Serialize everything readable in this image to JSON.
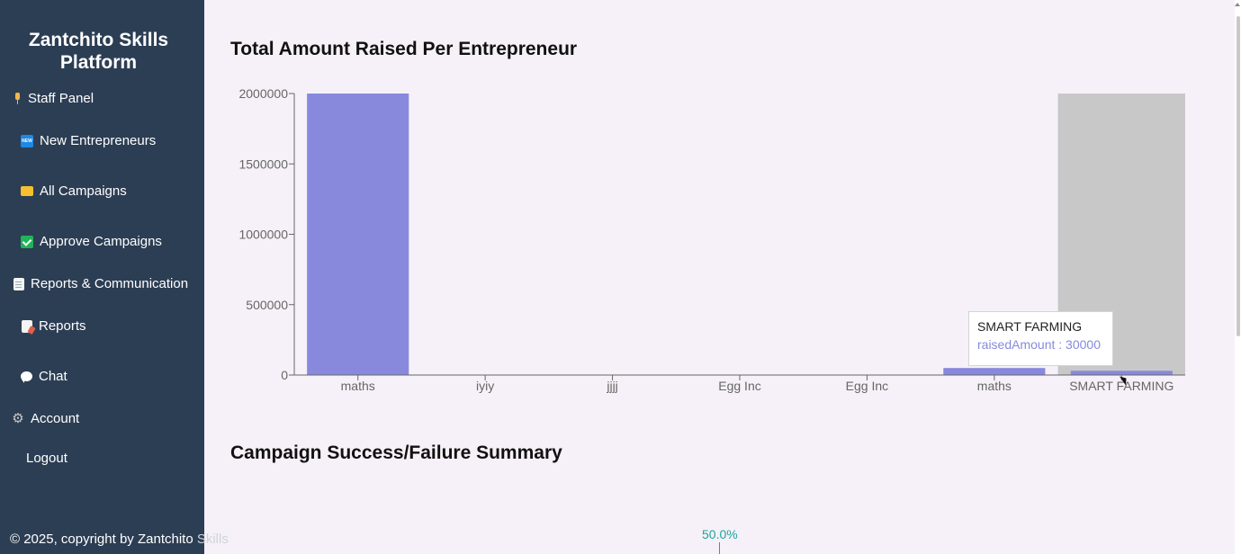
{
  "sidebar": {
    "brand": "Zantchito Skills Platform",
    "items": [
      {
        "label": "Staff Panel",
        "icon": "pushpin-icon"
      },
      {
        "label": "New Entrepreneurs",
        "icon": "new-badge-icon"
      },
      {
        "label": "All Campaigns",
        "icon": "folder-icon"
      },
      {
        "label": "Approve Campaigns",
        "icon": "checkmark-icon"
      },
      {
        "label": "Reports & Communication",
        "icon": "document-icon"
      },
      {
        "label": "Reports",
        "icon": "memo-icon"
      },
      {
        "label": "Chat",
        "icon": "speech-bubble-icon"
      },
      {
        "label": "Account",
        "icon": "gear-icon"
      },
      {
        "label": "Logout",
        "icon": ""
      }
    ]
  },
  "footer": {
    "text_main": "© 2025, copyright by Zantchito ",
    "text_faded": "Skills"
  },
  "main": {
    "chart_title": "Total Amount Raised Per Entrepreneur",
    "summary_title": "Campaign Success/Failure Summary",
    "pie_label": "50.0%"
  },
  "tooltip": {
    "title": "SMART FARMING",
    "line": "raisedAmount : 30000"
  },
  "colors": {
    "sidebar": "#2c3e54",
    "bar": "#8889dd",
    "hover": "#c8c8c8",
    "pie_label": "#19a7a0"
  },
  "chart_data": {
    "type": "bar",
    "title": "Total Amount Raised Per Entrepreneur",
    "categories": [
      "maths",
      "iyiy",
      "jjjj",
      "Egg Inc",
      "Egg Inc",
      "maths",
      "SMART FARMING"
    ],
    "series": [
      {
        "values": [
          2000000,
          0,
          0,
          0,
          0,
          50000,
          30000
        ]
      }
    ],
    "y_ticks": [
      0,
      500000,
      1000000,
      1500000,
      2000000
    ],
    "ylim": [
      0,
      2000000
    ],
    "highlighted_category_index": 6,
    "grid": false
  }
}
